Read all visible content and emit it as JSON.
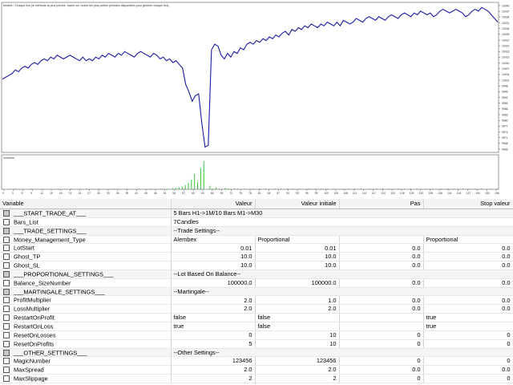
{
  "chart": {
    "header_text": "Modèle / Chaque tick (la méthode la plus précise, basée sur toutes les plus petites périodes disponibles pour générer chaque tick)",
    "volume_label": "Volumes",
    "y_ticks": [
      "10040",
      "10037",
      "10034",
      "10031",
      "10028",
      "10025",
      "10022",
      "10019",
      "10016",
      "10013",
      "10010",
      "10007",
      "10004",
      "10001",
      "9998",
      "9995",
      "9992",
      "9989",
      "9986",
      "9983",
      "9980",
      "9977",
      "9974",
      "9971",
      "9968",
      "9965"
    ],
    "x_ticks": [
      "0",
      "3",
      "6",
      "9",
      "12",
      "15",
      "18",
      "21",
      "24",
      "27",
      "30",
      "33",
      "36",
      "39",
      "42",
      "45",
      "48",
      "51",
      "54",
      "57",
      "60",
      "63",
      "66",
      "69",
      "72",
      "75",
      "78",
      "81",
      "84",
      "87",
      "90",
      "93",
      "96",
      "99",
      "102",
      "105",
      "108",
      "111",
      "114",
      "117",
      "120",
      "123",
      "126",
      "129",
      "132",
      "135",
      "138",
      "141",
      "144",
      "147",
      "150",
      "153",
      "156"
    ],
    "line_color": "#1a1aa6",
    "volume_color": "#22bb22"
  },
  "chart_data": {
    "type": "line",
    "series": [
      {
        "values": [
          10002,
          10003,
          10004,
          10005,
          10007,
          10006,
          10008,
          10009,
          10008,
          10010,
          10011,
          10010,
          10012,
          10013,
          10012,
          10014,
          10013,
          10015,
          10014,
          10013,
          10014,
          10015,
          10014,
          10013,
          10012,
          10014,
          10012,
          10013,
          10012,
          10014,
          10013,
          10015,
          10014,
          10016,
          10015,
          10014,
          10016,
          10015,
          10017,
          10016,
          10015,
          10014,
          10016,
          10017,
          10016,
          10015,
          10014,
          10016,
          10015,
          10013,
          10014,
          10012,
          10013,
          10011,
          10012,
          10010,
          10008,
          9999,
          9995,
          9990,
          9993,
          9994,
          9978,
          9965,
          9966,
          10018,
          10021,
          10020,
          10015,
          10013,
          10016,
          10014,
          10017,
          10016,
          10019,
          10018,
          10021,
          10022,
          10021,
          10023,
          10022,
          10024,
          10023,
          10025,
          10024,
          10026,
          10025,
          10027,
          10028,
          10026,
          10029,
          10028,
          10030,
          10029,
          10031,
          10030,
          10032,
          10031,
          10030,
          10032,
          10031,
          10033,
          10032,
          10031,
          10033,
          10031,
          10034,
          10033,
          10032,
          10033,
          10035,
          10034,
          10033,
          10035,
          10036,
          10035,
          10034,
          10036,
          10035,
          10034,
          10036,
          10037,
          10036,
          10035,
          10037,
          10038,
          10037,
          10036,
          10038,
          10037,
          10039,
          10038,
          10037,
          10038,
          10036,
          10037,
          10039,
          10040,
          10039,
          10038,
          10039,
          10040,
          10039,
          10038,
          10036,
          10037,
          10039,
          10040,
          10039,
          10041,
          10040,
          10039,
          10037,
          10035,
          10033
        ]
      }
    ],
    "volumes": [
      0,
      0,
      0,
      0,
      1,
      0,
      0,
      0,
      0,
      1,
      0,
      0,
      0,
      1,
      0,
      0,
      0,
      0,
      1,
      0,
      0,
      0,
      1,
      0,
      0,
      0,
      0,
      1,
      0,
      0,
      0,
      1,
      0,
      0,
      0,
      0,
      1,
      0,
      0,
      0,
      1,
      0,
      0,
      0,
      1,
      0,
      0,
      0,
      1,
      0,
      0,
      1,
      0,
      1,
      0,
      2,
      2,
      3,
      4,
      6,
      9,
      14,
      22,
      10,
      30,
      40,
      0,
      5,
      1,
      3,
      1,
      0,
      2,
      1,
      0,
      1,
      1,
      0,
      1,
      0,
      0,
      1,
      0,
      1,
      0,
      1,
      0,
      0,
      1,
      0,
      1,
      0,
      1,
      0,
      1,
      0,
      1,
      0,
      0,
      1,
      0,
      1,
      0,
      1,
      0,
      1,
      0,
      1,
      0,
      0,
      1,
      0,
      1,
      0,
      1,
      0,
      1,
      0,
      0,
      1,
      0,
      1,
      0,
      1,
      0,
      1,
      0,
      0,
      1,
      0,
      1,
      0,
      1,
      0,
      1,
      0,
      0,
      1,
      0,
      1,
      0,
      0,
      1,
      0,
      1,
      0,
      1,
      0,
      0,
      1,
      0,
      1,
      0,
      1,
      0,
      1,
      0,
      0,
      1,
      0,
      1
    ],
    "ylim": [
      9963,
      10042
    ],
    "grid": false
  },
  "table": {
    "headers": [
      "Variable",
      "Valeur",
      "Valeur initiale",
      "Pas",
      "Stop valeur"
    ],
    "rows": [
      {
        "name": "___START_TRADE_AT___",
        "value": "5 Bars H1->1M/10 Bars M1->M30",
        "initial": "",
        "step": "",
        "stop": "",
        "section": true,
        "merge": true
      },
      {
        "name": "Bars_List",
        "value": "7Candles",
        "initial": "",
        "step": "",
        "stop": "",
        "section": false,
        "merge": true
      },
      {
        "name": "___TRADE_SETTINGS___",
        "value": "--Trade Settings--",
        "initial": "",
        "step": "",
        "stop": "",
        "section": true,
        "merge": true
      },
      {
        "name": "Money_Management_Type",
        "value": "Alembex",
        "initial": "Proportional",
        "step": "",
        "stop": "Proportional",
        "section": false,
        "textcols": true
      },
      {
        "name": "LotStart",
        "value": "0.01",
        "initial": "0.01",
        "step": "0.0",
        "stop": "0.0",
        "section": false
      },
      {
        "name": "Ghost_TP",
        "value": "10.0",
        "initial": "10.0",
        "step": "0.0",
        "stop": "0.0",
        "section": false
      },
      {
        "name": "Ghost_SL",
        "value": "10.0",
        "initial": "10.0",
        "step": "0.0",
        "stop": "0.0",
        "section": false
      },
      {
        "name": "___PROPORTIONAL_SETTINGS___",
        "value": "--Lot Based On Balance--",
        "initial": "",
        "step": "",
        "stop": "",
        "section": true,
        "merge": true
      },
      {
        "name": "Balance_SizeNumber",
        "value": "100000.0",
        "initial": "100000.0",
        "step": "0.0",
        "stop": "0.0",
        "section": false
      },
      {
        "name": "___MARTINGALE_SETTINGS___",
        "value": "--Martingale--",
        "initial": "",
        "step": "",
        "stop": "",
        "section": true,
        "merge": true
      },
      {
        "name": "ProfitMultiplier",
        "value": "2.0",
        "initial": "1.0",
        "step": "0.0",
        "stop": "0.0",
        "section": false
      },
      {
        "name": "LossMultiplier",
        "value": "2.0",
        "initial": "2.0",
        "step": "0.0",
        "stop": "0.0",
        "section": false
      },
      {
        "name": "RestartOnProfit",
        "value": "false",
        "initial": "false",
        "step": "",
        "stop": "true",
        "section": false,
        "textcols": true
      },
      {
        "name": "RestartOnLoss",
        "value": "true",
        "initial": "false",
        "step": "",
        "stop": "true",
        "section": false,
        "textcols": true
      },
      {
        "name": "ResetOnLosses",
        "value": "0",
        "initial": "10",
        "step": "0",
        "stop": "0",
        "section": false
      },
      {
        "name": "ResetOnProfits",
        "value": "5",
        "initial": "10",
        "step": "0",
        "stop": "0",
        "section": false
      },
      {
        "name": "___OTHER_SETTINGS___",
        "value": "--Other Settings--",
        "initial": "",
        "step": "",
        "stop": "",
        "section": true,
        "merge": true
      },
      {
        "name": "MagicNumber",
        "value": "123456",
        "initial": "123456",
        "step": "0",
        "stop": "0",
        "section": false
      },
      {
        "name": "MaxSpread",
        "value": "2.0",
        "initial": "2.0",
        "step": "0.0",
        "stop": "0.0",
        "section": false
      },
      {
        "name": "MaxSlippage",
        "value": "2",
        "initial": "2",
        "step": "0",
        "stop": "0",
        "section": false
      }
    ]
  }
}
